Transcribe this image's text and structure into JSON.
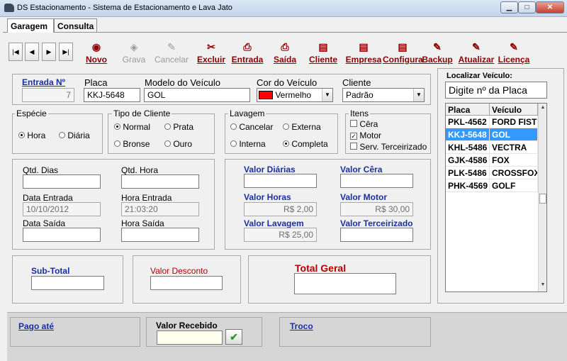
{
  "window": {
    "title": "DS Estacionamento - Sistema de Estacionamento e Lava Jato",
    "min": "▁",
    "max": "□",
    "close": "✕"
  },
  "tabs": [
    "Garagem",
    "Consulta"
  ],
  "nav": [
    "|◀",
    "◀",
    "▶",
    "▶|"
  ],
  "toolbar": [
    {
      "label": "Novo",
      "icon": "◉",
      "enabled": true
    },
    {
      "label": "Grava",
      "icon": "◈",
      "enabled": false
    },
    {
      "label": "Cancelar",
      "icon": "✎",
      "enabled": false
    },
    {
      "label": "Excluir",
      "icon": "✂",
      "enabled": true
    },
    {
      "label": "Entrada",
      "icon": "⎙",
      "enabled": true
    },
    {
      "label": "Saída",
      "icon": "⎙",
      "enabled": true
    },
    {
      "label": "Cliente",
      "icon": "▤",
      "enabled": true
    },
    {
      "label": "Empresa",
      "icon": "▤",
      "enabled": true
    },
    {
      "label": "Configura",
      "icon": "▤",
      "enabled": true
    },
    {
      "label": "Backup",
      "icon": "✎",
      "enabled": true
    },
    {
      "label": "Atualizar",
      "icon": "✎",
      "enabled": true
    },
    {
      "label": "Licença",
      "icon": "✎",
      "enabled": true
    }
  ],
  "entry": {
    "entrada_label": "Entrada Nº",
    "entrada_value": "7",
    "placa_label": "Placa",
    "placa_value": "KKJ-5648",
    "modelo_label": "Modelo do Veículo",
    "modelo_value": "GOL",
    "cor_label": "Cor do Veículo",
    "cor_value": "Vermelho",
    "cor_swatch": "#ff0000",
    "cliente_label": "Cliente",
    "cliente_value": "Padrão"
  },
  "especie": {
    "label": "Espécie",
    "options": [
      "Hora",
      "Diária"
    ],
    "selected": 0
  },
  "tipo_cliente": {
    "label": "Tipo de Cliente",
    "options": [
      "Normal",
      "Prata",
      "Bronse",
      "Ouro"
    ],
    "selected": 0
  },
  "lavagem": {
    "label": "Lavagem",
    "options": [
      "Cancelar",
      "Externa",
      "Interna",
      "Completa"
    ],
    "selected": 3
  },
  "itens": {
    "label": "Itens",
    "options": [
      "Cêra",
      "Motor",
      "Serv. Terceirizado"
    ],
    "checked": [
      false,
      true,
      false
    ]
  },
  "tempo": {
    "qtd_dias_label": "Qtd. Dias",
    "qtd_dias": "",
    "qtd_hora_label": "Qtd. Hora",
    "qtd_hora": "",
    "data_entrada_label": "Data Entrada",
    "data_entrada": "10/10/2012",
    "hora_entrada_label": "Hora Entrada",
    "hora_entrada": "21:03:20",
    "data_saida_label": "Data Saída",
    "data_saida": "",
    "hora_saida_label": "Hora Saída",
    "hora_saida": ""
  },
  "valores": {
    "diarias_label": "Valor Diárias",
    "diarias": "",
    "cera_label": "Valor Cêra",
    "cera": "",
    "horas_label": "Valor Horas",
    "horas": "R$ 2,00",
    "motor_label": "Valor Motor",
    "motor": "R$ 30,00",
    "lavagem_label": "Valor Lavagem",
    "lavagem": "R$ 25,00",
    "terceirizado_label": "Valor Terceirizado",
    "terceirizado": ""
  },
  "totais": {
    "subtotal_label": "Sub-Total",
    "subtotal": "",
    "desconto_label": "Valor Desconto",
    "desconto": "",
    "total_label": "Total Geral",
    "total": ""
  },
  "pagamento": {
    "pago_ate_label": "Pago até",
    "recebido_label": "Valor Recebido",
    "recebido": "",
    "confirm_icon": "✔",
    "troco_label": "Troco"
  },
  "localizar": {
    "label": "Localizar Veículo:",
    "placeholder": "Digite nº da Placa",
    "columns": [
      "Placa",
      "Veículo"
    ],
    "rows": [
      {
        "placa": "PKL-4562",
        "veiculo": "FORD FIST"
      },
      {
        "placa": "KKJ-5648",
        "veiculo": "GOL"
      },
      {
        "placa": "KHL-5486",
        "veiculo": "VECTRA"
      },
      {
        "placa": "GJK-4586",
        "veiculo": "FOX"
      },
      {
        "placa": "PLK-5486",
        "veiculo": "CROSSFOX"
      },
      {
        "placa": "PHK-4569",
        "veiculo": "GOLF"
      }
    ],
    "selected_row": 1
  }
}
